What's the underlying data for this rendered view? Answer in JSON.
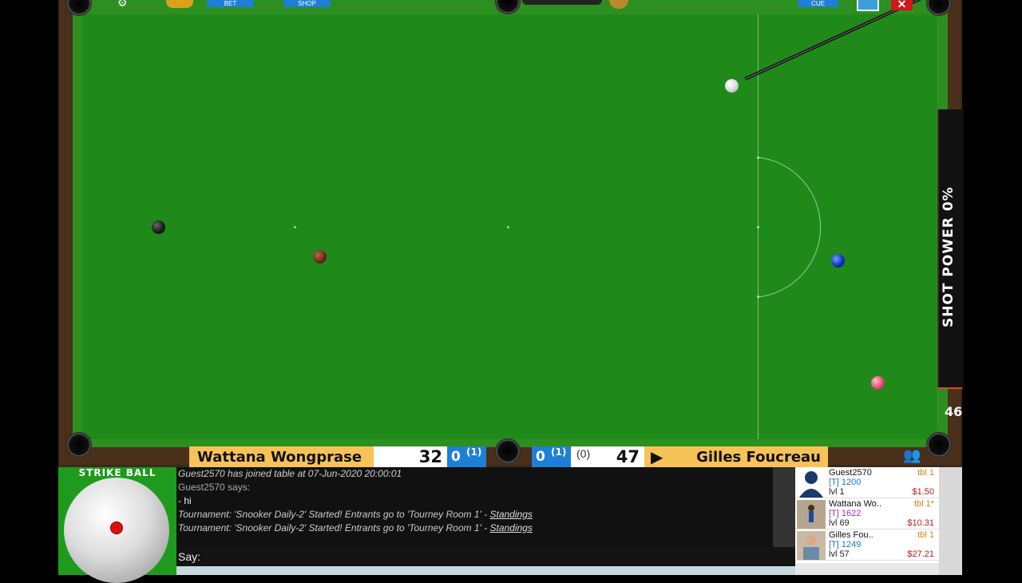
{
  "top_bar": {
    "bet_label": "BET",
    "shop_label": "SHOP",
    "cue_label": "CUE"
  },
  "power": {
    "label": "SHOT POWER 0%",
    "value_label": "46"
  },
  "scoreboard": {
    "left_player": "Wattana Wongprase",
    "left_score": "32",
    "left_frames": "0",
    "left_frames_total": "(1)",
    "right_frames": "0",
    "right_frames_total": "(1)",
    "right_break": "(0)",
    "right_score": "47",
    "right_player": "Gilles Foucreau",
    "turn_indicator": "▶"
  },
  "strike_ball": {
    "title": "STRIKE BALL"
  },
  "chat": {
    "lines": [
      {
        "text": "Guest2570 has joined table at 07-Jun-2020 20:00:01"
      },
      {
        "text": "Guest2570 says:"
      },
      {
        "text": " - hi"
      },
      {
        "text": "Tournament: 'Snooker Daily-2' Started! Entrants go to 'Tourney Room 1' - ",
        "link": "Standings"
      },
      {
        "text": "Tournament: 'Snooker Daily-2' Started! Entrants go to 'Tourney Room 1' - ",
        "link": "Standings"
      }
    ],
    "say_label": "Say:"
  },
  "players": [
    {
      "name": "Guest2570",
      "rating": "[T] 1200",
      "level": "lvl 1",
      "table": "tbl 1",
      "money": "$1.50"
    },
    {
      "name": "Wattana Wo..",
      "rating": "[T] 1622",
      "level": "lvl 69",
      "table": "tbl 1*",
      "money": "$10.31"
    },
    {
      "name": "Gilles Fou..",
      "rating": "[T] 1249",
      "level": "lvl 57",
      "table": "tbl 1",
      "money": "$27.21"
    }
  ],
  "colors": {
    "felt": "#1f8a1a",
    "score_gold": "#f7c258",
    "frame_blue": "#1e7fd6",
    "power_bg": "#111111"
  }
}
